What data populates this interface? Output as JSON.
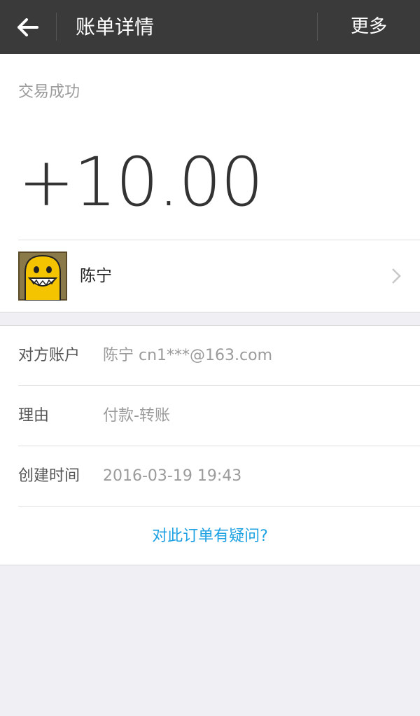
{
  "header": {
    "back_icon": "arrow-left-icon",
    "title": "账单详情",
    "more_label": "更多"
  },
  "transaction": {
    "status": "交易成功",
    "amount": "+10.00"
  },
  "payer": {
    "name": "陈宁",
    "avatar": "yellow-monster-avatar",
    "chevron_icon": "chevron-right-icon"
  },
  "details": [
    {
      "label": "对方账户",
      "value": "陈宁 cn1***@163.com"
    },
    {
      "label": "理由",
      "value": "付款-转账"
    },
    {
      "label": "创建时间",
      "value": "2016-03-19 19:43"
    }
  ],
  "help_link": "对此订单有疑问?",
  "colors": {
    "header_bg": "#3a3a3a",
    "page_bg": "#efeff4",
    "link": "#1da1e2",
    "avatar_yellow": "#f5c400"
  }
}
